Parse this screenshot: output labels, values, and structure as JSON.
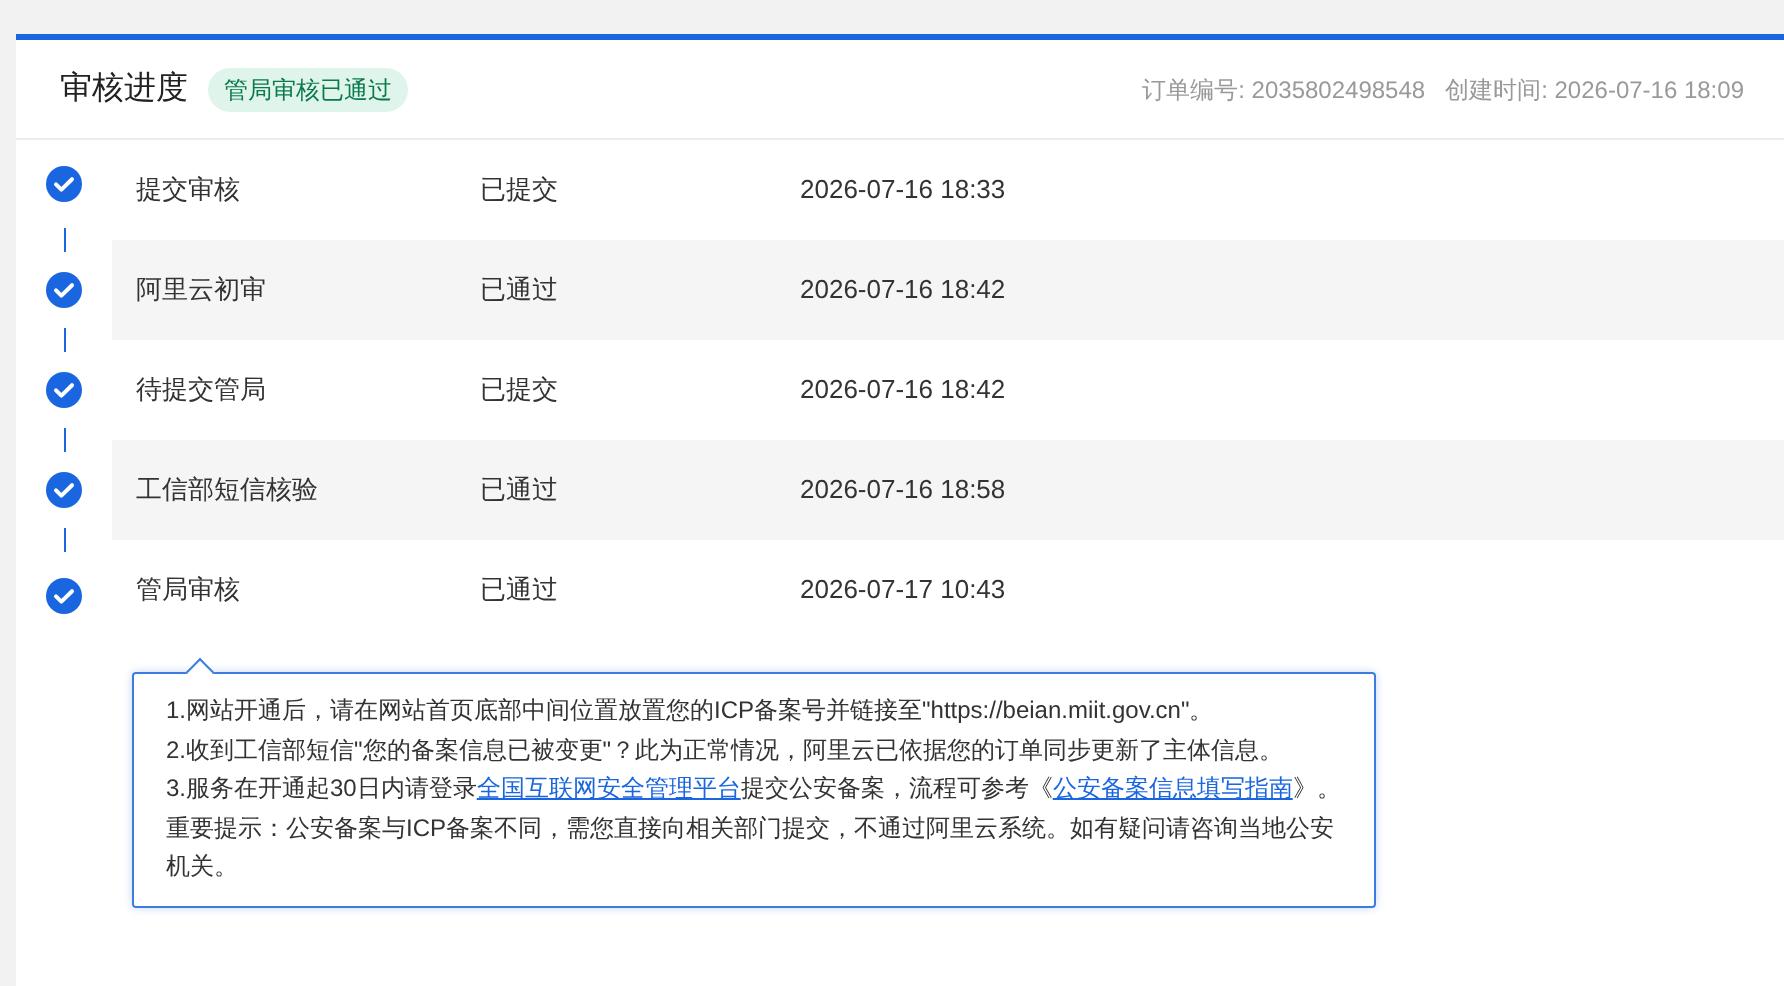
{
  "header": {
    "title": "审核进度",
    "status_badge": "管局审核已通过",
    "order_label": "订单编号: 2035802498548",
    "created_label": "创建时间: 2026-07-16 18:09"
  },
  "steps": [
    {
      "name": "提交审核",
      "status": "已提交",
      "time": "2026-07-16 18:33",
      "done": true
    },
    {
      "name": "阿里云初审",
      "status": "已通过",
      "time": "2026-07-16 18:42",
      "done": true
    },
    {
      "name": "待提交管局",
      "status": "已提交",
      "time": "2026-07-16 18:42",
      "done": true
    },
    {
      "name": "工信部短信核验",
      "status": "已通过",
      "time": "2026-07-16 18:58",
      "done": true
    },
    {
      "name": "管局审核",
      "status": "已通过",
      "time": "2026-07-17 10:43",
      "done": true
    }
  ],
  "notice": [
    [
      {
        "text": "1.网站开通后，请在网站首页底部中间位置放置您的ICP备案号并链接至\"https://beian.miit.gov.cn\"。",
        "link": false
      }
    ],
    [
      {
        "text": "2.收到工信部短信\"您的备案信息已被变更\"？此为正常情况，阿里云已依据您的订单同步更新了主体信息。",
        "link": false
      }
    ],
    [
      {
        "text": "3.服务在开通起30日内请登录",
        "link": false
      },
      {
        "text": "全国互联网安全管理平台",
        "link": true
      },
      {
        "text": "提交公安备案，流程可参考《",
        "link": false
      },
      {
        "text": "公安备案信息填写指南",
        "link": true
      },
      {
        "text": "》。",
        "link": false
      }
    ],
    [
      {
        "text": "重要提示：公安备案与ICP备案不同，需您直接向相关部门提交，不通过阿里云系统。如有疑问请咨询当地公安机关。",
        "link": false
      }
    ]
  ]
}
